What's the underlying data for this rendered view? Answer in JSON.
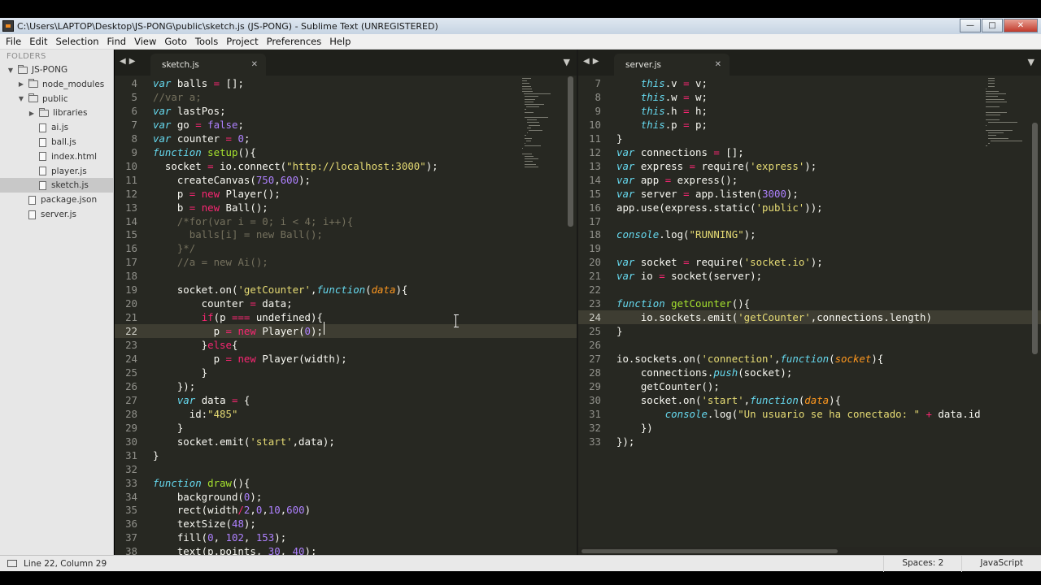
{
  "window": {
    "title": "C:\\Users\\LAPTOP\\Desktop\\JS-PONG\\public\\sketch.js (JS-PONG) - Sublime Text (UNREGISTERED)"
  },
  "menu": [
    "File",
    "Edit",
    "Selection",
    "Find",
    "View",
    "Goto",
    "Tools",
    "Project",
    "Preferences",
    "Help"
  ],
  "sidebar": {
    "heading": "FOLDERS",
    "items": [
      {
        "label": "JS-PONG",
        "type": "folder",
        "depth": 0,
        "expanded": true
      },
      {
        "label": "node_modules",
        "type": "folder",
        "depth": 1,
        "expanded": false
      },
      {
        "label": "public",
        "type": "folder",
        "depth": 1,
        "expanded": true
      },
      {
        "label": "libraries",
        "type": "folder",
        "depth": 2,
        "expanded": false
      },
      {
        "label": "ai.js",
        "type": "file",
        "depth": 2
      },
      {
        "label": "ball.js",
        "type": "file",
        "depth": 2
      },
      {
        "label": "index.html",
        "type": "file",
        "depth": 2
      },
      {
        "label": "player.js",
        "type": "file",
        "depth": 2
      },
      {
        "label": "sketch.js",
        "type": "file",
        "depth": 2,
        "selected": true
      },
      {
        "label": "package.json",
        "type": "file",
        "depth": 1
      },
      {
        "label": "server.js",
        "type": "file",
        "depth": 1
      }
    ]
  },
  "panes": [
    {
      "tab": "sketch.js",
      "current_line": 22,
      "lines": [
        {
          "n": 4,
          "html": "<span class='k'>var</span> balls <span class='kw'>=</span> [];"
        },
        {
          "n": 5,
          "html": "<span class='cm'>//var a;</span>"
        },
        {
          "n": 6,
          "html": "<span class='k'>var</span> lastPos;"
        },
        {
          "n": 7,
          "html": "<span class='k'>var</span> go <span class='kw'>=</span> <span class='nm'>false</span>;"
        },
        {
          "n": 8,
          "html": "<span class='k'>var</span> counter <span class='kw'>=</span> <span class='nm'>0</span>;"
        },
        {
          "n": 9,
          "html": "<span class='k'>function</span> <span class='fn'>setup</span>(){"
        },
        {
          "n": 10,
          "html": "  socket <span class='kw'>=</span> io.connect(<span class='st'>\"http://localhost:3000\"</span>);"
        },
        {
          "n": 11,
          "html": "    createCanvas(<span class='nm'>750</span>,<span class='nm'>600</span>);"
        },
        {
          "n": 12,
          "html": "    p <span class='kw'>=</span> <span class='kw'>new</span> Player();"
        },
        {
          "n": 13,
          "html": "    b <span class='kw'>=</span> <span class='kw'>new</span> Ball();"
        },
        {
          "n": 14,
          "html": "    <span class='cm'>/*for(var i = 0; i &lt; 4; i++){</span>"
        },
        {
          "n": 15,
          "html": "<span class='cm'>      balls[i] = new Ball();</span>"
        },
        {
          "n": 16,
          "html": "<span class='cm'>    }*/</span>"
        },
        {
          "n": 17,
          "html": "    <span class='cm'>//a = new Ai();</span>"
        },
        {
          "n": 18,
          "html": ""
        },
        {
          "n": 19,
          "html": "    socket.on(<span class='st'>'getCounter'</span>,<span class='k'>function</span>(<span class='pm'>data</span>){"
        },
        {
          "n": 20,
          "html": "        counter <span class='kw'>=</span> data;"
        },
        {
          "n": 21,
          "html": "        <span class='kw'>if</span>(p <span class='kw'>===</span> undefined){"
        },
        {
          "n": 22,
          "html": "          p <span class='kw'>=</span> <span class='kw'>new</span> Player(<span class='nm'>0</span>);"
        },
        {
          "n": 23,
          "html": "        }<span class='kw'>else</span>{"
        },
        {
          "n": 24,
          "html": "          p <span class='kw'>=</span> <span class='kw'>new</span> Player(width);"
        },
        {
          "n": 25,
          "html": "        }"
        },
        {
          "n": 26,
          "html": "    });"
        },
        {
          "n": 27,
          "html": "    <span class='k'>var</span> data <span class='kw'>=</span> {"
        },
        {
          "n": 28,
          "html": "      id:<span class='st'>\"485\"</span>"
        },
        {
          "n": 29,
          "html": "    }"
        },
        {
          "n": 30,
          "html": "    socket.emit(<span class='st'>'start'</span>,data);"
        },
        {
          "n": 31,
          "html": "}"
        },
        {
          "n": 32,
          "html": ""
        },
        {
          "n": 33,
          "html": "<span class='k'>function</span> <span class='fn'>draw</span>(){"
        },
        {
          "n": 34,
          "html": "    background(<span class='nm'>0</span>);"
        },
        {
          "n": 35,
          "html": "    rect(width<span class='kw'>/</span><span class='nm'>2</span>,<span class='nm'>0</span>,<span class='nm'>10</span>,<span class='nm'>600</span>)"
        },
        {
          "n": 36,
          "html": "    textSize(<span class='nm'>48</span>);"
        },
        {
          "n": 37,
          "html": "    fill(<span class='nm'>0</span>, <span class='nm'>102</span>, <span class='nm'>153</span>);"
        },
        {
          "n": 38,
          "html": "    text(p.points, <span class='nm'>30</span>, <span class='nm'>40</span>);"
        }
      ]
    },
    {
      "tab": "server.js",
      "current_line": 24,
      "lines": [
        {
          "n": 7,
          "html": "    <span class='k'>this</span>.v <span class='kw'>=</span> v;"
        },
        {
          "n": 8,
          "html": "    <span class='k'>this</span>.w <span class='kw'>=</span> w;"
        },
        {
          "n": 9,
          "html": "    <span class='k'>this</span>.h <span class='kw'>=</span> h;"
        },
        {
          "n": 10,
          "html": "    <span class='k'>this</span>.p <span class='kw'>=</span> p;"
        },
        {
          "n": 11,
          "html": "}"
        },
        {
          "n": 12,
          "html": "<span class='k'>var</span> connections <span class='kw'>=</span> [];"
        },
        {
          "n": 13,
          "html": "<span class='k'>var</span> express <span class='kw'>=</span> require(<span class='st'>'express'</span>);"
        },
        {
          "n": 14,
          "html": "<span class='k'>var</span> app <span class='kw'>=</span> express();"
        },
        {
          "n": 15,
          "html": "<span class='k'>var</span> server <span class='kw'>=</span> app.listen(<span class='nm'>3000</span>);"
        },
        {
          "n": 16,
          "html": "app.use(express.static(<span class='st'>'public'</span>));"
        },
        {
          "n": 17,
          "html": ""
        },
        {
          "n": 18,
          "html": "<span class='k'>console</span>.log(<span class='st'>\"RUNNING\"</span>);"
        },
        {
          "n": 19,
          "html": ""
        },
        {
          "n": 20,
          "html": "<span class='k'>var</span> socket <span class='kw'>=</span> require(<span class='st'>'socket.io'</span>);"
        },
        {
          "n": 21,
          "html": "<span class='k'>var</span> io <span class='kw'>=</span> socket(server);"
        },
        {
          "n": 22,
          "html": ""
        },
        {
          "n": 23,
          "html": "<span class='k'>function</span> <span class='fn'>getCounter</span>(){"
        },
        {
          "n": 24,
          "html": "    io.sockets.emit(<span class='st'>'getCounter'</span>,connections.length)"
        },
        {
          "n": 25,
          "html": "}"
        },
        {
          "n": 26,
          "html": ""
        },
        {
          "n": 27,
          "html": "io.sockets.on(<span class='st'>'connection'</span>,<span class='k'>function</span>(<span class='pm'>socket</span>){"
        },
        {
          "n": 28,
          "html": "    connections.<span class='k'>push</span>(socket);"
        },
        {
          "n": 29,
          "html": "    getCounter();"
        },
        {
          "n": 30,
          "html": "    socket.on(<span class='st'>'start'</span>,<span class='k'>function</span>(<span class='pm'>data</span>){"
        },
        {
          "n": 31,
          "html": "        <span class='k'>console</span>.log(<span class='st'>\"Un usuario se ha conectado: \"</span> <span class='kw'>+</span> data.id"
        },
        {
          "n": 32,
          "html": "    })"
        },
        {
          "n": 33,
          "html": "});"
        }
      ]
    }
  ],
  "status": {
    "position": "Line 22, Column 29",
    "spaces": "Spaces: 2",
    "syntax": "JavaScript"
  },
  "colors": {
    "editor_bg": "#272822",
    "keyword": "#f92672",
    "storage": "#66d9ef",
    "function": "#a6e22e",
    "string": "#e6db74",
    "number": "#ae81ff",
    "comment": "#75715e"
  }
}
